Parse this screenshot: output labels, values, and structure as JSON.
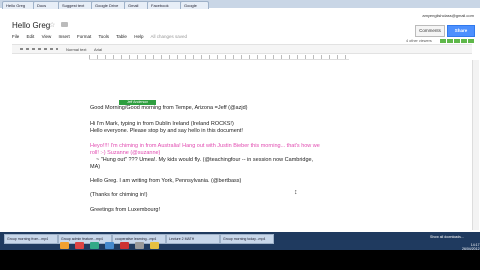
{
  "browser": {
    "tabs": [
      "Hello Greg",
      "Docs",
      "Suggest text",
      "Google Drive",
      "Gmail",
      "Facebook",
      "Google"
    ]
  },
  "account": "amyenglishclass@gmail.com",
  "doc": {
    "title": "Hello Greg",
    "menu": [
      "File",
      "Edit",
      "View",
      "Insert",
      "Format",
      "Tools",
      "Table",
      "Help"
    ],
    "saved_status": "All changes saved",
    "comments_label": "Comments",
    "share_label": "Share",
    "viewers": "4 other viewers",
    "toolbar_style": "Normal text",
    "toolbar_font": "Arial"
  },
  "content": {
    "chip_label": "Jeff Anderson",
    "line1": "Good Morning/Good morning from Tempe, Arizona  =Jeff (@azjd)",
    "line2": "Hi I'm Mark, typing in from Dublin Ireland (Ireland ROCKS!)",
    "line3": "Hello everyone. Please stop by and say hello in this document!",
    "line4": "Heyo!!!! I'm chiming in from Australia! Hang out with Justin Bieber this morning... that's how we",
    "line5": "roll! :-) Suzanne (@suzanne)",
    "line6": "~ \"Hung out\" ??? Umea!. My kids would fly. (@teachingfour -- in session now Cambridge,",
    "line7": "MA)",
    "line8": "Hello Greg.  I am writing from York, Pennsylvania.   (@bertbass)",
    "line9": "(Thanks for chiming in!)",
    "line10": "Greetings from Luxembourg!"
  },
  "taskbar": {
    "tasks": [
      "Group morning from...mp4",
      "Group admin feature...mp4",
      "cooperative learning...mp4",
      "Lecture 2 MATH",
      "Group morning today...mp4"
    ],
    "downloads_label": "Show all downloads...",
    "time": "14:17",
    "date": "26/04/2012"
  }
}
